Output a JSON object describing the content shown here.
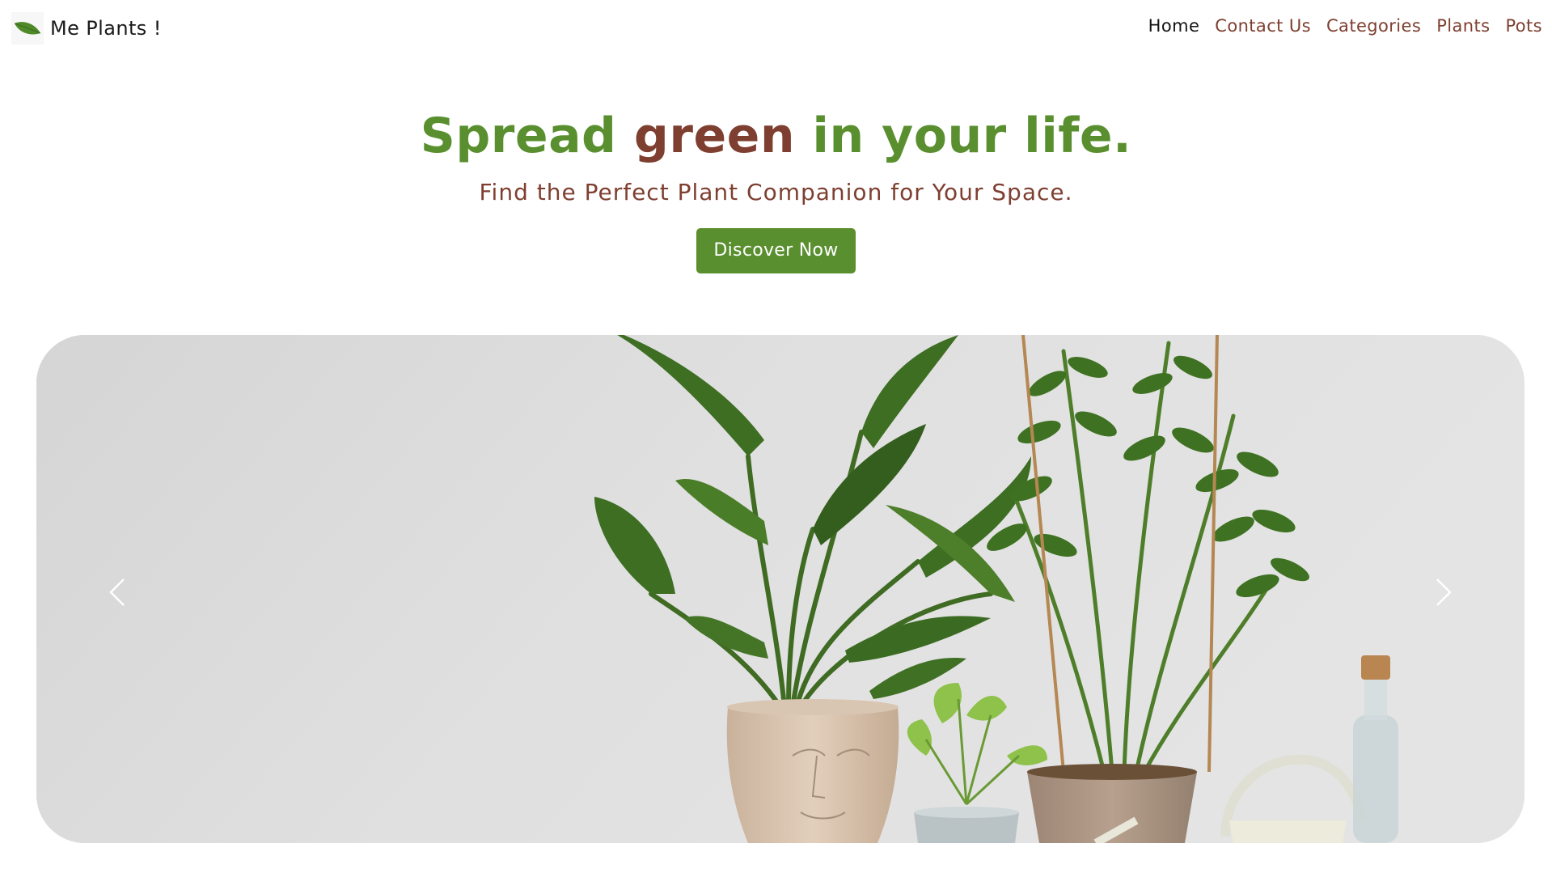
{
  "brand": {
    "name": "Me Plants !",
    "logo_icon": "leaf-icon",
    "accent_color": "#5a8f2f"
  },
  "nav": {
    "items": [
      {
        "label": "Home",
        "active": true
      },
      {
        "label": "Contact Us",
        "active": false
      },
      {
        "label": "Categories",
        "active": false
      },
      {
        "label": "Plants",
        "active": false
      },
      {
        "label": "Pots",
        "active": false
      }
    ],
    "link_color": "#7e3f30",
    "active_color": "#141414"
  },
  "hero": {
    "title_before": "Spread ",
    "title_accent": "green",
    "title_after": " in your life.",
    "subtitle": "Find the Perfect Plant Companion for Your Space.",
    "cta_label": "Discover Now",
    "title_color": "#5a8f2f",
    "accent_color": "#7e3f30"
  },
  "carousel": {
    "prev_icon": "chevron-left-icon",
    "next_icon": "chevron-right-icon"
  }
}
